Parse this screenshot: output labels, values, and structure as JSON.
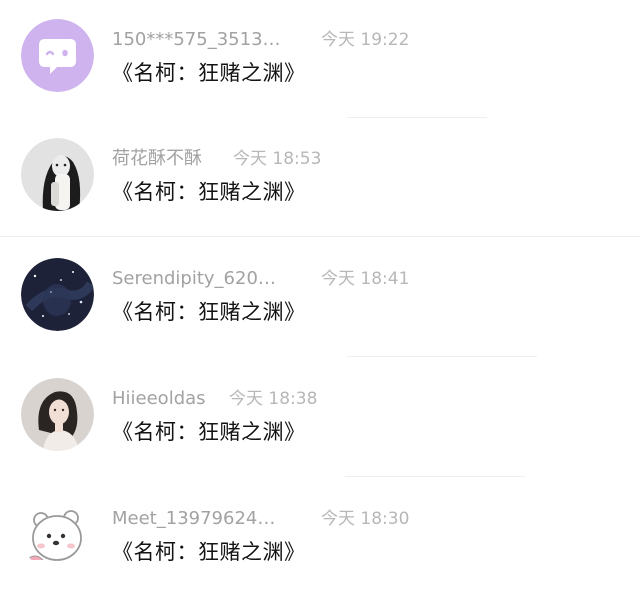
{
  "comments": [
    {
      "username": "150***575_3513…",
      "time": "今天 19:22",
      "text": "《名柯：狂赌之渊》",
      "avatar_icon": "chat-bubble-icon",
      "avatar_color": "#cfb3ef"
    },
    {
      "username": "荷花酥不酥",
      "time": "今天 18:53",
      "text": "《名柯：狂赌之渊》",
      "avatar_icon": "user-photo-icon",
      "avatar_color": "#e2e2e2"
    },
    {
      "username": "Serendipity_620…",
      "time": "今天 18:41",
      "text": "《名柯：狂赌之渊》",
      "avatar_icon": "starry-sky-icon",
      "avatar_color": "#1d2238"
    },
    {
      "username": "Hiieeoldas",
      "time": "今天 18:38",
      "text": "《名柯：狂赌之渊》",
      "avatar_icon": "portrait-photo-icon",
      "avatar_color": "#d9d3cf"
    },
    {
      "username": "Meet_13979624…",
      "time": "今天 18:30",
      "text": "《名柯：狂赌之渊》",
      "avatar_icon": "white-bear-icon",
      "avatar_color": "#ffffff"
    }
  ]
}
